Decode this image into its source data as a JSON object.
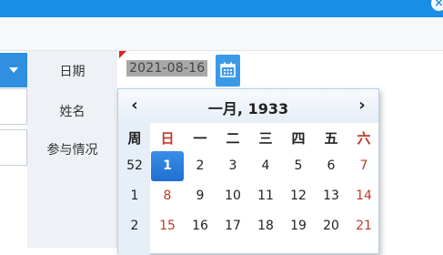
{
  "window": {
    "close_glyph": "×",
    "accent": "#1a8ee6"
  },
  "form": {
    "labels": [
      "日期",
      "姓名",
      "参与情况"
    ],
    "date_value": "2021-08-16"
  },
  "calendar": {
    "prev": "‹",
    "next": "›",
    "title": "一月, 1933",
    "week_header": "周",
    "weekdays": [
      "日",
      "一",
      "二",
      "三",
      "四",
      "五",
      "六"
    ],
    "rows": [
      {
        "week": "52",
        "days": [
          "1",
          "2",
          "3",
          "4",
          "5",
          "6",
          "7"
        ]
      },
      {
        "week": "1",
        "days": [
          "8",
          "9",
          "10",
          "11",
          "12",
          "13",
          "14"
        ]
      },
      {
        "week": "2",
        "days": [
          "15",
          "16",
          "17",
          "18",
          "19",
          "20",
          "21"
        ]
      }
    ],
    "selected_day": "1",
    "weekend_color": "#c0392b",
    "selected_color": "#1f6fd0"
  }
}
